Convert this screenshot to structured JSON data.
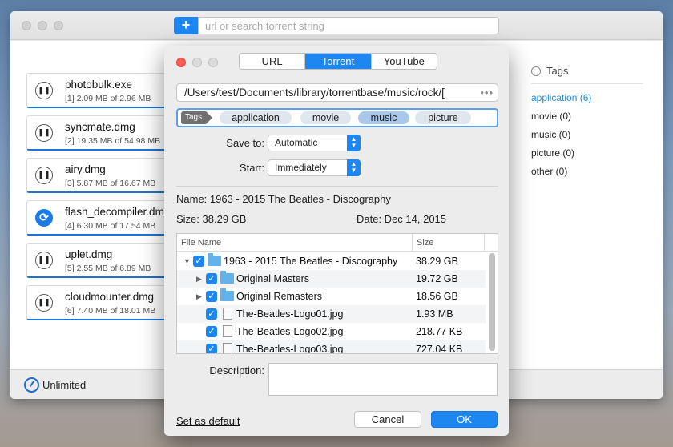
{
  "search": {
    "placeholder": "url or search torrent string",
    "add_label": "+"
  },
  "downloads": [
    {
      "name": "photobulk.exe",
      "meta": "[1] 2.09 MB of 2.96 MB",
      "status": "pause-icon",
      "icon_glyph": "❚❚"
    },
    {
      "name": "syncmate.dmg",
      "meta": "[2] 19.35 MB of 54.98 MB",
      "status": "pause-icon",
      "icon_glyph": "❚❚"
    },
    {
      "name": "airy.dmg",
      "meta": "[3] 5.87 MB of 16.67 MB",
      "status": "pause-icon",
      "icon_glyph": "❚❚"
    },
    {
      "name": "flash_decompiler.dmg",
      "meta": "[4] 6.30 MB of 17.54 MB",
      "status": "sync-icon",
      "icon_glyph": "⟳"
    },
    {
      "name": "uplet.dmg",
      "meta": "[5] 2.55 MB of 6.89 MB",
      "status": "pause-icon",
      "icon_glyph": "❚❚"
    },
    {
      "name": "cloudmounter.dmg",
      "meta": "[6] 7.40 MB of 18.01 MB",
      "status": "pause-icon",
      "icon_glyph": "❚❚"
    }
  ],
  "tags_panel": {
    "title": "Tags",
    "items": [
      {
        "label": "application (6)",
        "active": true
      },
      {
        "label": "movie (0)"
      },
      {
        "label": "music (0)"
      },
      {
        "label": "picture (0)"
      },
      {
        "label": "other (0)"
      }
    ]
  },
  "speed": {
    "label": "Unlimited"
  },
  "dialog": {
    "tabs": [
      {
        "label": "URL"
      },
      {
        "label": "Torrent",
        "selected": true
      },
      {
        "label": "YouTube"
      }
    ],
    "path": "/Users/test/Documents/library/torrentbase/music/rock/[",
    "path_dots": "•••",
    "tags_label": "Tags",
    "tags": [
      {
        "label": "application"
      },
      {
        "label": "movie"
      },
      {
        "label": "music",
        "selected": true
      },
      {
        "label": "picture"
      }
    ],
    "save_to_label": "Save to:",
    "save_to_value": "Automatic",
    "start_label": "Start:",
    "start_value": "Immediately",
    "name_line": "Name:  1963 - 2015 The Beatles - Discography",
    "size_line": "Size:  38.29 GB",
    "date_line": "Date:  Dec 14, 2015",
    "table_headers": {
      "name": "File Name",
      "size": "Size"
    },
    "files": [
      {
        "name": "1963 - 2015 The Beatles - Discography",
        "size": "38.29 GB",
        "kind": "folder",
        "expanded": true,
        "level": 0
      },
      {
        "name": "Original Masters",
        "size": "19.72 GB",
        "kind": "folder",
        "expanded": false,
        "level": 1
      },
      {
        "name": "Original Remasters",
        "size": "18.56 GB",
        "kind": "folder",
        "expanded": false,
        "level": 1
      },
      {
        "name": "The-Beatles-Logo01.jpg",
        "size": "1.93 MB",
        "kind": "file",
        "level": 1
      },
      {
        "name": "The-Beatles-Logo02.jpg",
        "size": "218.77 KB",
        "kind": "file",
        "level": 1
      },
      {
        "name": "The-Beatles-Logo03.jpg",
        "size": "727.04 KB",
        "kind": "file",
        "level": 1
      }
    ],
    "description_label": "Description:",
    "set_default_label": "Set as default",
    "cancel_label": "Cancel",
    "ok_label": "OK"
  }
}
